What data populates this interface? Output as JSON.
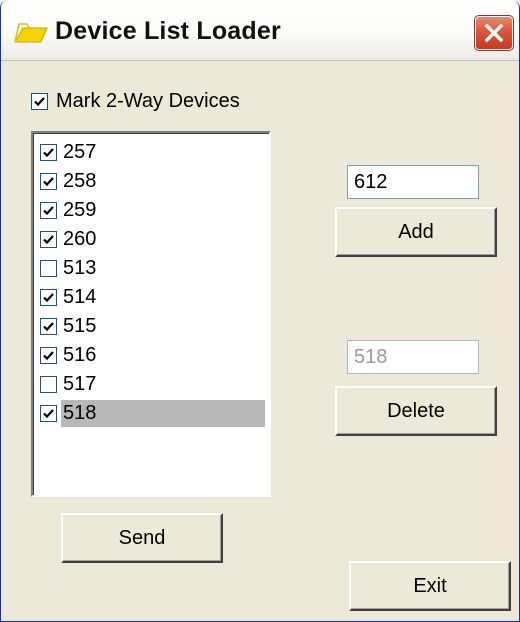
{
  "window": {
    "title": "Device List Loader",
    "close_icon": "close-icon",
    "app_icon": "folder-arrow-icon"
  },
  "options": {
    "mark_two_way": {
      "label": "Mark 2-Way Devices",
      "checked": true
    }
  },
  "device_list": {
    "items": [
      {
        "label": "257",
        "checked": true,
        "selected": false
      },
      {
        "label": "258",
        "checked": true,
        "selected": false
      },
      {
        "label": "259",
        "checked": true,
        "selected": false
      },
      {
        "label": "260",
        "checked": true,
        "selected": false
      },
      {
        "label": "513",
        "checked": false,
        "selected": false
      },
      {
        "label": "514",
        "checked": true,
        "selected": false
      },
      {
        "label": "515",
        "checked": true,
        "selected": false
      },
      {
        "label": "516",
        "checked": true,
        "selected": false
      },
      {
        "label": "517",
        "checked": false,
        "selected": false
      },
      {
        "label": "518",
        "checked": true,
        "selected": true
      }
    ]
  },
  "add": {
    "input_value": "612",
    "button_label": "Add"
  },
  "delete": {
    "input_value": "518",
    "button_label": "Delete"
  },
  "send": {
    "button_label": "Send"
  },
  "exit": {
    "button_label": "Exit"
  },
  "colors": {
    "titlebar_text": "#101010",
    "close_button": "#d8573a",
    "selection": "#b9b8b8",
    "face": "#ece9d8"
  }
}
